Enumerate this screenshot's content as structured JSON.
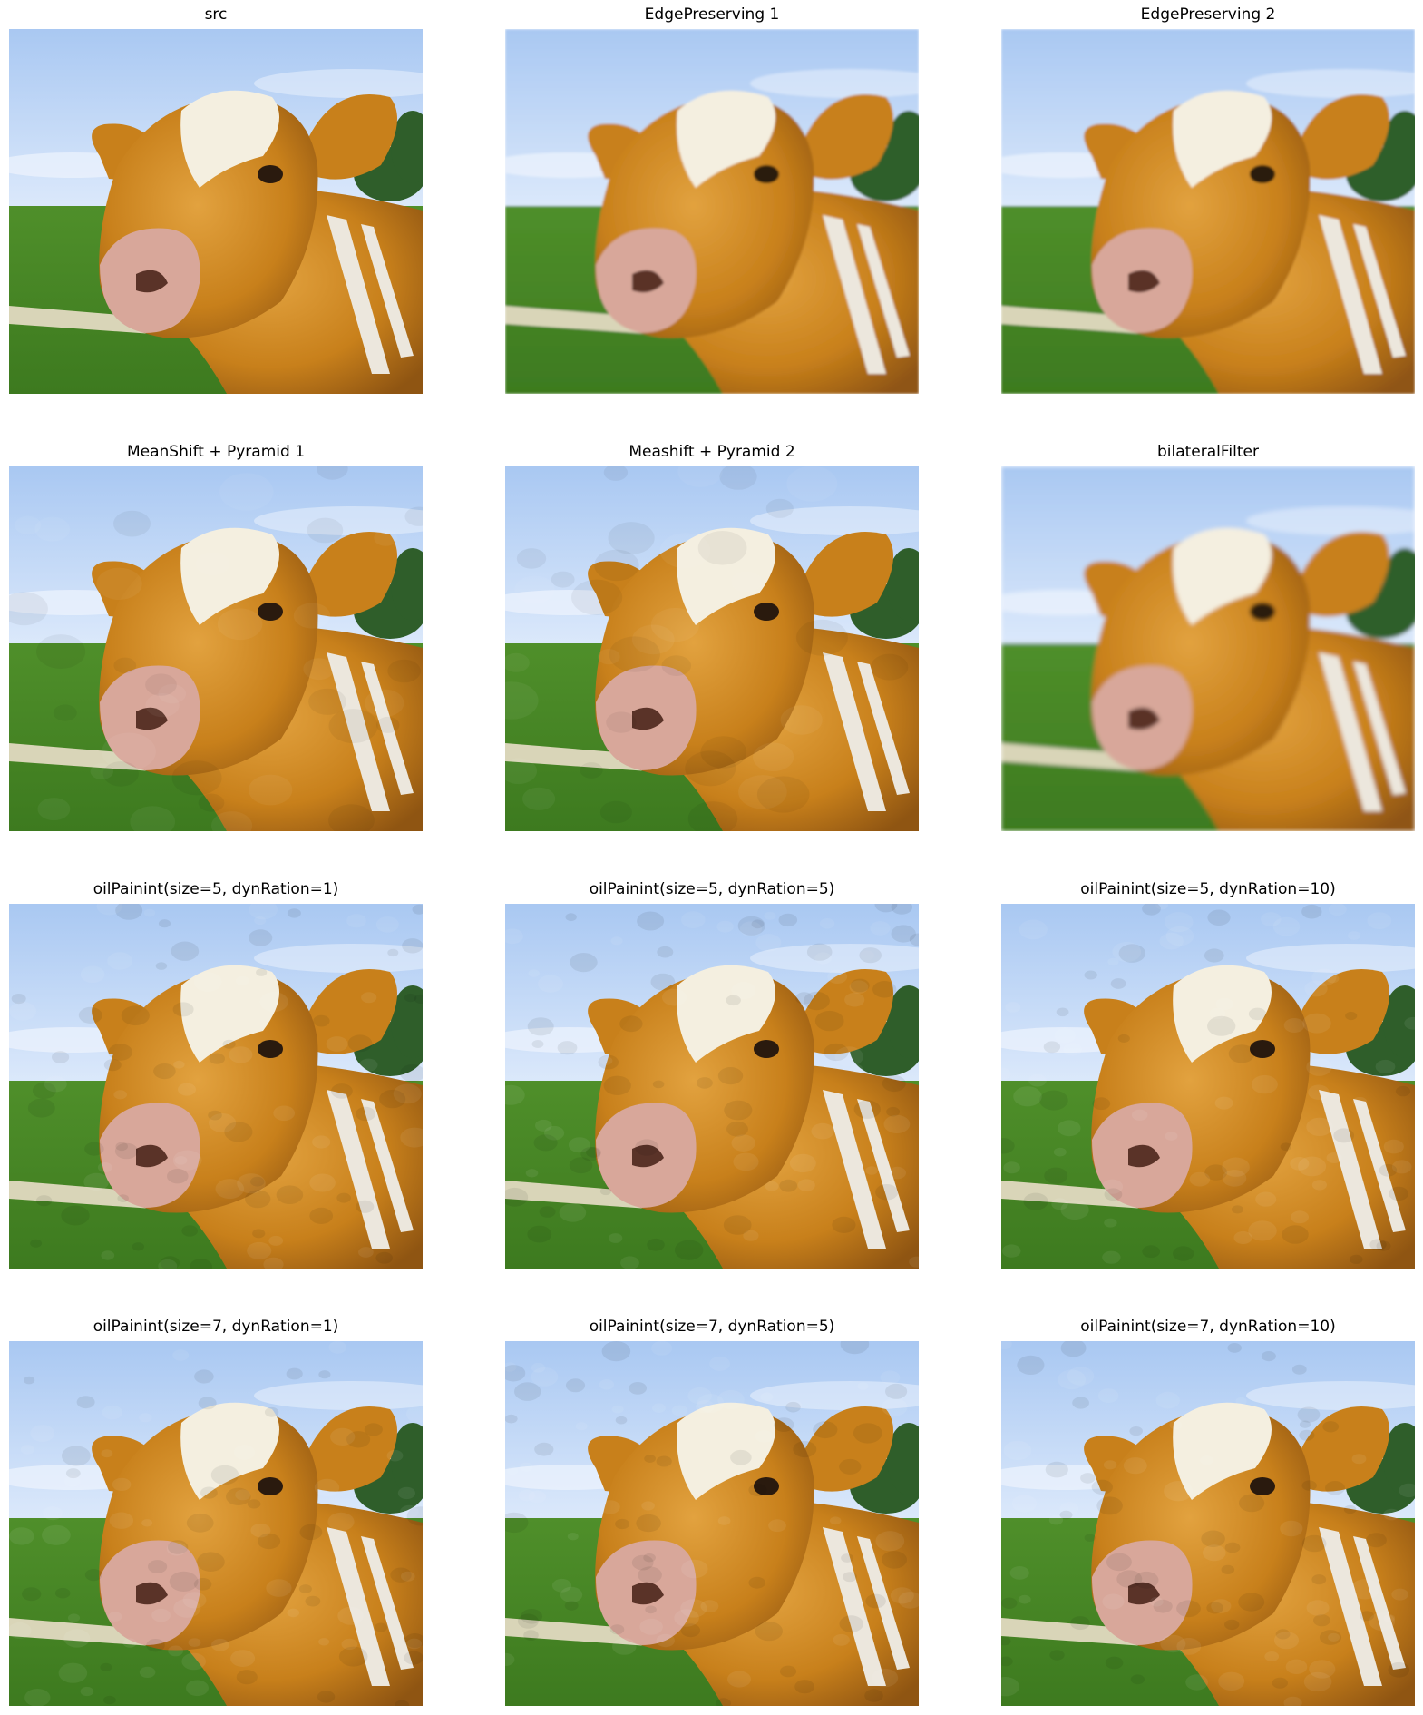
{
  "figure": {
    "panels": [
      {
        "title": "src",
        "style": "src"
      },
      {
        "title": "EdgePreserving 1",
        "style": "smooth"
      },
      {
        "title": "EdgePreserving 2",
        "style": "smooth"
      },
      {
        "title": "MeanShift + Pyramid 1",
        "style": "flat"
      },
      {
        "title": "Meashift + Pyramid 2",
        "style": "flat"
      },
      {
        "title": "bilateralFilter",
        "style": "blur"
      },
      {
        "title": "oilPainint(size=5, dynRation=1)",
        "style": "oil"
      },
      {
        "title": "oilPainint(size=5, dynRation=5)",
        "style": "oil"
      },
      {
        "title": "oilPainint(size=5, dynRation=10)",
        "style": "oil"
      },
      {
        "title": "oilPainint(size=7, dynRation=1)",
        "style": "oil"
      },
      {
        "title": "oilPainint(size=7, dynRation=5)",
        "style": "oil"
      },
      {
        "title": "oilPainint(size=7, dynRation=10)",
        "style": "oil"
      }
    ]
  },
  "palette": {
    "sky_top": "#a9c8f2",
    "sky_bottom": "#dce9fb",
    "grass_top": "#4f8f2a",
    "grass_bottom": "#3d7a1f",
    "cow_body": "#c8801b",
    "cow_shadow": "#8f5512",
    "cow_light": "#e2a23f",
    "blaze": "#f4efe0",
    "muzzle": "#d8a79a",
    "fence": "#8b958a",
    "trees": "#2f5e2a"
  }
}
